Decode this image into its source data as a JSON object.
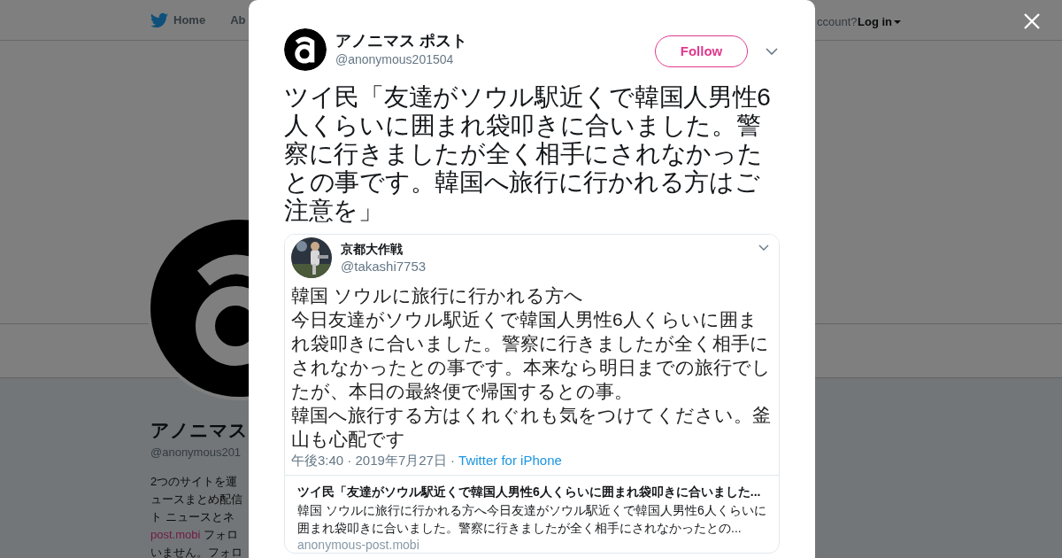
{
  "top_nav": {
    "items": [
      "Home",
      "Ab"
    ],
    "account_prompt": "ccount?",
    "login": "Log in"
  },
  "profile": {
    "name": "アノニマス",
    "handle": "@anonymous201",
    "bio_lines": [
      {
        "kind": "text",
        "text": "2つのサイトを運"
      },
      {
        "kind": "text",
        "text": "ュースまとめ配信"
      },
      {
        "kind": "text",
        "text": "ト ニュースとネ"
      },
      {
        "kind": "link_text",
        "link": "post.mobi",
        "text": "フォロ"
      },
      {
        "kind": "text",
        "text": "いません。フォロ"
      }
    ]
  },
  "modal": {
    "author": {
      "name": "アノニマス ポスト",
      "handle": "@anonymous201504"
    },
    "follow_button": "Follow",
    "text": "ツイ民「友達がソウル駅近くで韓国人男性6人くらいに囲まれ袋叩きに合いました。警察に行きましたが全く相手にされなかったとの事です。韓国へ旅行に行かれる方はご注意を」",
    "card": {
      "image": {
        "author_name": "京都大作戦",
        "handle": "@takashi7753",
        "text_lines": [
          "韓国 ソウルに旅行に行かれる方へ",
          "今日友達がソウル駅近くで韓国人男性6人くらいに囲ま",
          "れ袋叩きに合いました。警察に行きましたが全く相手に",
          "されなかったとの事です。本来なら明日までの旅行でし",
          "たが、本日の最終便で帰国するとの事。",
          "韓国へ旅行する方はくれぐれも気をつけてください。釜",
          "山も心配です"
        ],
        "meta": {
          "text": "午後3:40 · 2019年7月27日 ·",
          "link": "Twitter for iPhone"
        }
      },
      "title": "ツイ民「友達がソウル駅近くで韓国人男性6人くらいに囲まれ袋叩きに合いました...",
      "description": "韓国 ソウルに旅行に行かれる方へ今日友達がソウル駅近くで韓国人男性6人くらいに囲まれ袋叩きに合いました。警察に行きましたが全く相手にされなかったとの...",
      "domain": "anonymous-post.mobi"
    }
  }
}
